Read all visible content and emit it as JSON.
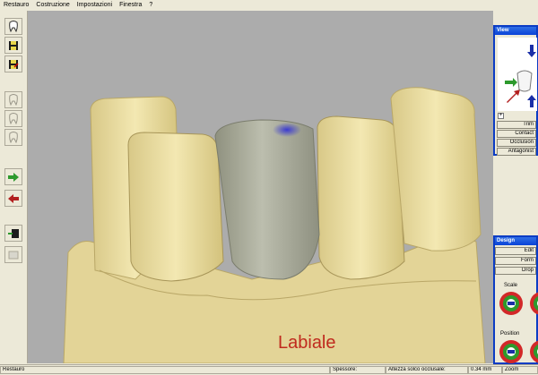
{
  "menu": [
    "Restauro",
    "Costruzione",
    "Impostazioni",
    "Finestra",
    "?"
  ],
  "viewport": {
    "label": "Labiale"
  },
  "view_panel": {
    "title": "View",
    "buttons": [
      "Trim",
      "Contact",
      "Occlusion",
      "Antagonist"
    ]
  },
  "design_panel": {
    "title": "Design",
    "buttons": [
      "Edit",
      "Form",
      "Drop"
    ],
    "scale_label": "Scale",
    "position_label": "Position"
  },
  "status": {
    "mode": "Restauro",
    "spessore_label": "Spessore:",
    "altezza_label": "Altezza solco occlusale:",
    "altezza_value": "0.34 mm",
    "zoom": "Zoom"
  },
  "colors": {
    "tooth": "#ecdfa2",
    "crown": "#a9ac9b",
    "accent": "#0b3cc4",
    "label_red": "#c02a1e"
  }
}
